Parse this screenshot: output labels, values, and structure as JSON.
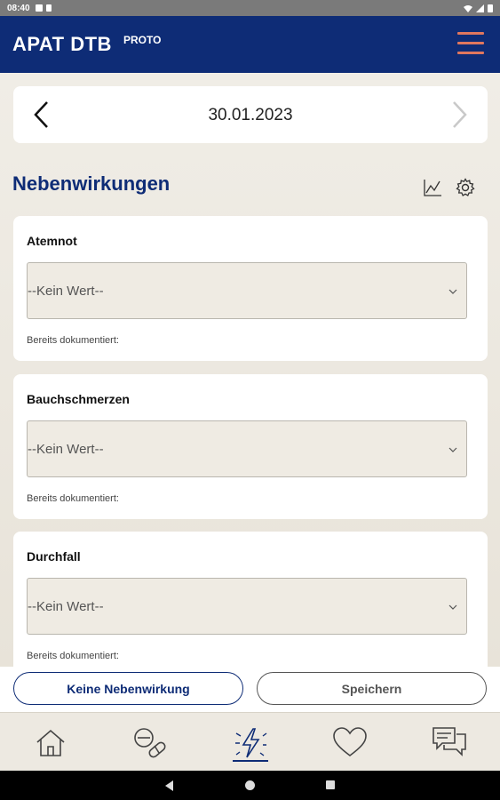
{
  "status_bar": {
    "time": "08:40"
  },
  "app_bar": {
    "title": "APAT DTB",
    "badge": "PROTO",
    "menu_icon": "hamburger-menu-icon",
    "accent_color": "#e0775e",
    "background_color": "#0e2c76"
  },
  "date_nav": {
    "date": "30.01.2023",
    "prev_icon": "chevron-left-icon",
    "next_icon": "chevron-right-icon"
  },
  "section": {
    "title": "Nebenwirkungen",
    "chart_icon": "line-chart-icon",
    "settings_icon": "gear-icon"
  },
  "side_effects": [
    {
      "label": "Atemnot",
      "value": "--Kein Wert--",
      "documented_label": "Bereits dokumentiert:"
    },
    {
      "label": "Bauchschmerzen",
      "value": "--Kein Wert--",
      "documented_label": "Bereits dokumentiert:"
    },
    {
      "label": "Durchfall",
      "value": "--Kein Wert--",
      "documented_label": "Bereits dokumentiert:"
    }
  ],
  "actions": {
    "no_side_effect": "Keine Nebenwirkung",
    "save": "Speichern"
  },
  "bottom_nav": {
    "items": [
      {
        "icon": "home-icon"
      },
      {
        "icon": "pills-icon"
      },
      {
        "icon": "lightning-icon",
        "active": true
      },
      {
        "icon": "heart-icon"
      },
      {
        "icon": "chat-icon"
      }
    ]
  }
}
